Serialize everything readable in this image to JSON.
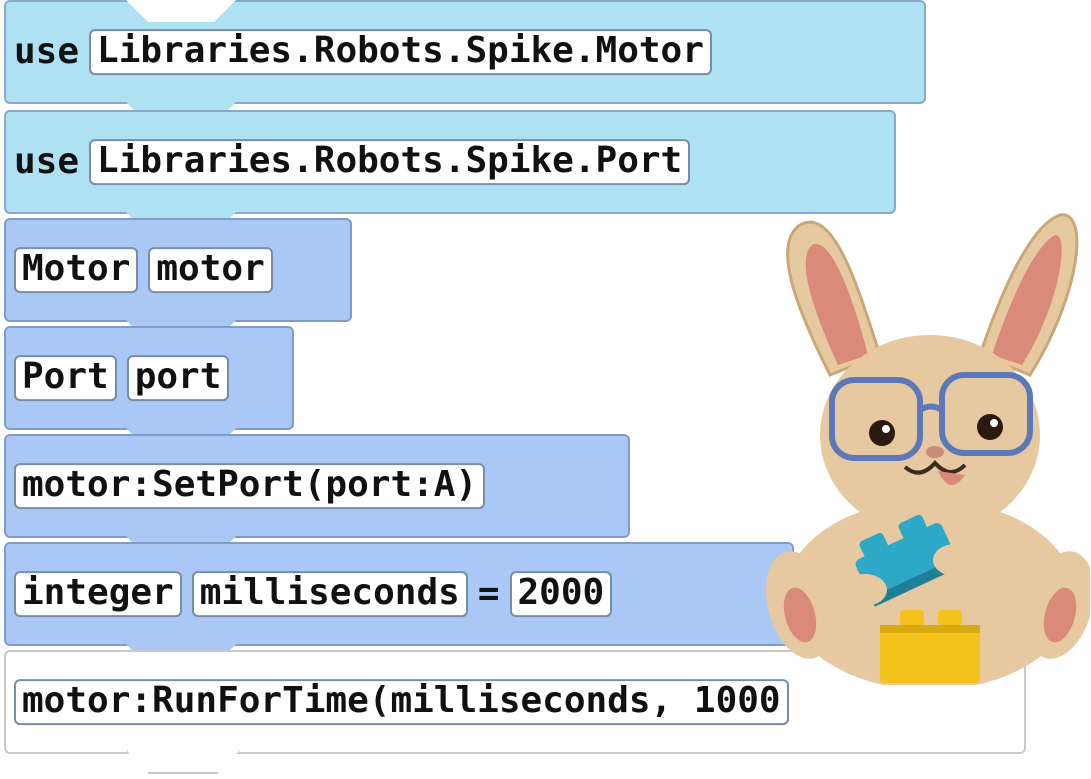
{
  "blocks": [
    {
      "keyword": "use",
      "value": "Libraries.Robots.Spike.Motor"
    },
    {
      "keyword": "use",
      "value": "Libraries.Robots.Spike.Port"
    },
    {
      "type": "Motor",
      "name": "motor"
    },
    {
      "type": "Port",
      "name": "port"
    },
    {
      "statement": "motor:SetPort(port:A)"
    },
    {
      "type": "integer",
      "name": "milliseconds",
      "operator": "=",
      "value": "2000"
    },
    {
      "statement": "motor:RunForTime(milliseconds, 1000"
    }
  ],
  "colors": {
    "use_block": "#aee2f2",
    "code_block": "#a9c8f6",
    "active_block": "#ffffff"
  },
  "mascot": {
    "icon": "bunny-with-glasses-mascot"
  }
}
